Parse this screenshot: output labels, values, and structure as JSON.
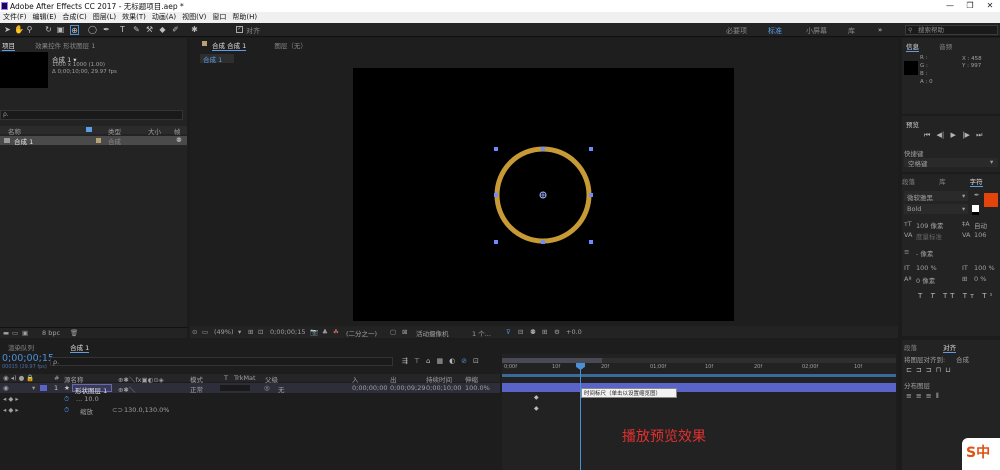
{
  "window": {
    "title": "Adobe After Effects CC 2017 - 无标题项目.aep *",
    "minimize": "—",
    "restore": "❐",
    "close": "✕"
  },
  "menu": [
    "文件(F)",
    "编辑(E)",
    "合成(C)",
    "图层(L)",
    "效果(T)",
    "动画(A)",
    "视图(V)",
    "窗口",
    "帮助(H)"
  ],
  "toolbar": {
    "align_label": "对齐",
    "workspaces": [
      "必要项",
      "标准",
      "小屏幕",
      "库"
    ],
    "active_workspace": "标准",
    "search_placeholder": "搜索帮助",
    "more": "»"
  },
  "project_panel": {
    "tab_project": "项目",
    "tab_effects": "效果控件 形状图层 1",
    "comp_name": "合成 1 ▾",
    "comp_info1": "1000 x 1000 (1.00)",
    "comp_info2": "Δ 0;00;10;00, 29.97 fps",
    "search_icon": "ρ.",
    "columns": {
      "name": "名称",
      "type": "类型",
      "size": "大小",
      "frame": "帧"
    },
    "item_name": "合成 1",
    "item_type": "合成",
    "bpc": "8 bpc"
  },
  "comp_panel": {
    "tab_comp": "合成 合成 1",
    "tab_layer": "图层（无）",
    "sub_tab": "合成 1",
    "zoom": "(49%)",
    "timecode": "0;00;00;15",
    "resolution": "(二分之一)",
    "camera": "活动摄像机",
    "views": "1 个...",
    "exposure": "+0.0",
    "circle_color": "#c79a35"
  },
  "info_panel": {
    "tab_info": "信息",
    "tab_audio": "音频",
    "r": "R :",
    "g": "G :",
    "b": "B :",
    "a": "A : 0",
    "x": "X : 458",
    "y": "Y : 997"
  },
  "preview_panel": {
    "title": "预览",
    "buttons": [
      "⏮",
      "◀|",
      "▶",
      "|▶",
      "⏭"
    ],
    "shortcut_label": "快捷键",
    "shortcut_value": "空格键"
  },
  "char_panel": {
    "tabs": [
      "段落",
      "库",
      "字符"
    ],
    "active_tab": "字符",
    "font": "微软雅黑",
    "style": "Bold",
    "size": "109 像素",
    "tracking": "自动",
    "kerning": "度量标准",
    "leading_val": "106",
    "stroke": "- 像素",
    "vscale": "100 %",
    "hscale": "100 %",
    "baseline": "0 像素",
    "tsume": "0 %",
    "styles": [
      "T",
      "T",
      "TT",
      "Tт",
      "T¹",
      "T₁"
    ],
    "fill_color": "#e2440c"
  },
  "align_panel": {
    "tabs": [
      "段落",
      "对齐"
    ],
    "align_to_label": "将图层对齐到:",
    "align_to_value": "合成",
    "distribute_label": "分布图层"
  },
  "timeline": {
    "tab_render": "渲染队列",
    "tab_comp": "合成 1",
    "timecode": "0;00;00;15",
    "fps_note": "00015 (29.97 fps)",
    "search": "ρ.",
    "columns": {
      "num": "#",
      "source": "源名称",
      "mode": "模式",
      "t": "T",
      "trkmat": "TrkMat",
      "parent": "父级",
      "in": "入",
      "out": "出",
      "duration": "持续时间",
      "stretch": "伸缩"
    },
    "ruler": [
      "0;00f",
      "10f",
      "20f",
      "01;00f",
      "10f",
      "20f",
      "02;00f",
      "10f"
    ],
    "layer": {
      "num": "1",
      "star": "★",
      "name": "形状图层 1",
      "mode": "正常",
      "parent": "无",
      "in": "0;00;00;00",
      "out": "0;00;09;29",
      "duration": "0;00;10;00",
      "stretch": "100.0%"
    },
    "prop1": {
      "name": "... 10.0"
    },
    "prop2": {
      "name": "缩放",
      "value": "130.0,130.0%"
    },
    "tooltip": "时间标尺（单击以设置缩览图）",
    "note": "播放预览效果"
  },
  "watermark": "S中"
}
